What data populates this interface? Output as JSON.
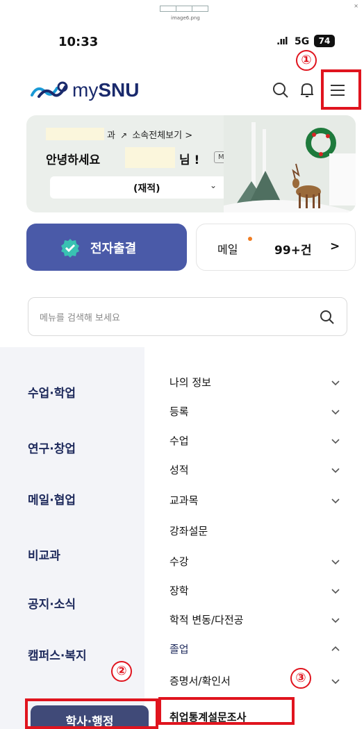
{
  "image_header": {
    "file_name": "image6.png"
  },
  "status_bar": {
    "time": "10:33",
    "signal": ".ııl",
    "network": "5G",
    "battery": "74"
  },
  "markers": [
    "①",
    "②",
    "③"
  ],
  "app": {
    "logo_prefix": "my",
    "logo_bold": "SNU"
  },
  "greeting": {
    "dept_suffix": "과",
    "dept_link": "소속전체보기 >",
    "hello": "안녕하세요",
    "honorific": "님 !",
    "my_badge": "MY",
    "status_value": "(재적)"
  },
  "quick": {
    "attendance_label": "전자출결",
    "mail_label": "메일",
    "mail_count": "99+건",
    "mail_arrow": ">"
  },
  "search": {
    "placeholder": "메뉴를 검색해 보세요"
  },
  "categories": [
    "수업·학업",
    "연구·창업",
    "메일·협업",
    "비교과",
    "공지·소식",
    "캠퍼스·복지",
    "학사·행정"
  ],
  "submenu": [
    "나의 정보",
    "등록",
    "수업",
    "성적",
    "교과목",
    "강좌설문",
    "수강",
    "장학",
    "학적 변동/다전공",
    "졸업",
    "증명서/확인서"
  ],
  "subsubmenu": [
    "취업통계설문조사"
  ],
  "colors": {
    "accent": "#4a5aa8",
    "highlight": "#e0141e",
    "dark_navy": "#1e2a5c"
  }
}
